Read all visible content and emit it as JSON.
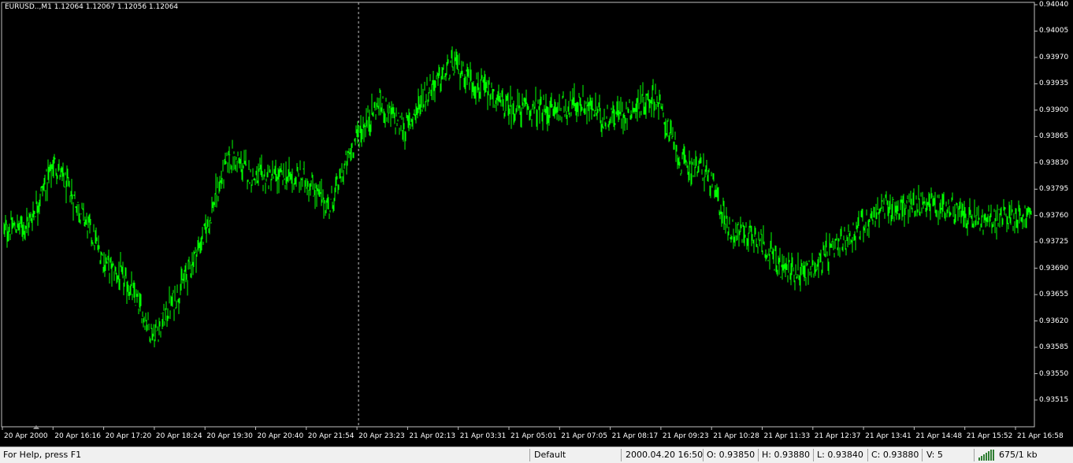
{
  "chart": {
    "info_label": "EURUSD..,M1  1.12064 1.12067 1.12056 1.12064",
    "bar_color": "#00ff00",
    "background": "#000000",
    "price_axis": [
      "0.94040",
      "0.94005",
      "0.93970",
      "0.93935",
      "0.93900",
      "0.93865",
      "0.93830",
      "0.93795",
      "0.93760",
      "0.93725",
      "0.93690",
      "0.93655",
      "0.93620",
      "0.93585",
      "0.93550",
      "0.93515"
    ],
    "time_axis": [
      "20 Apr 2000",
      "20 Apr 16:16",
      "20 Apr 17:20",
      "20 Apr 18:24",
      "20 Apr 19:30",
      "20 Apr 20:40",
      "20 Apr 21:54",
      "20 Apr 23:23",
      "21 Apr 02:13",
      "21 Apr 03:31",
      "21 Apr 05:01",
      "21 Apr 07:05",
      "21 Apr 08:17",
      "21 Apr 09:23",
      "21 Apr 10:28",
      "21 Apr 11:33",
      "21 Apr 12:37",
      "21 Apr 13:41",
      "21 Apr 14:48",
      "21 Apr 15:52",
      "21 Apr 16:58"
    ],
    "crosshair_position": "vertical dashed line at 20 Apr 23:23"
  },
  "chart_data": {
    "type": "bar",
    "title": "EURUSD..,M1",
    "ylim": [
      0.93515,
      0.9404
    ],
    "x": [
      "20 Apr 2000",
      "20 Apr 16:16",
      "20 Apr 17:20",
      "20 Apr 18:24",
      "20 Apr 19:30",
      "20 Apr 20:40",
      "20 Apr 21:54",
      "20 Apr 23:23",
      "21 Apr 02:13",
      "21 Apr 03:31",
      "21 Apr 05:01",
      "21 Apr 07:05",
      "21 Apr 08:17",
      "21 Apr 09:23",
      "21 Apr 10:28",
      "21 Apr 11:33",
      "21 Apr 12:37",
      "21 Apr 13:41",
      "21 Apr 14:48",
      "21 Apr 15:52",
      "21 Apr 16:58"
    ],
    "series": [
      {
        "values": [
          0.9374,
          0.9375,
          0.9383,
          0.9377,
          0.937,
          0.93665,
          0.936,
          0.9366,
          0.93735,
          0.9384,
          0.9381,
          0.9381,
          0.9381,
          0.9377,
          0.9386,
          0.9391,
          0.93875,
          0.9393,
          0.9396,
          0.9393,
          0.93905,
          0.939,
          0.939,
          0.9391,
          0.9389,
          0.939,
          0.9392,
          0.9383,
          0.9382,
          0.9374,
          0.93735,
          0.9369,
          0.93685,
          0.9371,
          0.9374,
          0.9377,
          0.9377,
          0.9378,
          0.93765,
          0.9375,
          0.9376,
          0.9376
        ]
      }
    ]
  },
  "status": {
    "help": "For Help, press F1",
    "profile": "Default",
    "datetime": "2000.04.20 16:50",
    "open": "O: 0.93850",
    "high": "H: 0.93880",
    "low": "L: 0.93840",
    "close": "C: 0.93880",
    "volume": "V: 5",
    "traffic": "675/1 kb"
  }
}
